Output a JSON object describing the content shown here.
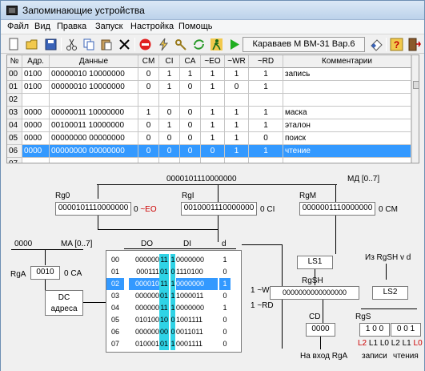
{
  "window": {
    "title": "Запоминающие устройства"
  },
  "menu": [
    "Файл",
    "Вид",
    "Правка",
    "Запуск",
    "Настройка",
    "Помощь"
  ],
  "toolbar": {
    "author_field": "Караваев М ВМ-31 Вар.6"
  },
  "icons": [
    "app-icon",
    "new-icon",
    "open-icon",
    "save-icon",
    "cut-icon",
    "copy-icon",
    "paste-icon",
    "delete-icon",
    "stop-icon",
    "step-icon",
    "key-icon",
    "refresh-icon",
    "run-man-icon",
    "play-icon",
    "eraser-icon",
    "help-icon",
    "exit-icon"
  ],
  "table": {
    "headers": [
      "№",
      "Адр.",
      "Данные",
      "CM",
      "CI",
      "CA",
      "~EO",
      "~WR",
      "~RD",
      "Комментарии"
    ],
    "rows": [
      [
        "00",
        "0100",
        "00000010  10000000",
        "0",
        "1",
        "1",
        "1",
        "1",
        "1",
        "запись"
      ],
      [
        "01",
        "0100",
        "00000010  10000000",
        "0",
        "1",
        "0",
        "1",
        "0",
        "1",
        ""
      ],
      [
        "02",
        "",
        "",
        "",
        "",
        "",
        "",
        "",
        "",
        ""
      ],
      [
        "03",
        "0000",
        "00000011  10000000",
        "1",
        "0",
        "0",
        "1",
        "1",
        "1",
        "маска"
      ],
      [
        "04",
        "0000",
        "00100011  10000000",
        "0",
        "1",
        "0",
        "1",
        "1",
        "1",
        "эталон"
      ],
      [
        "05",
        "0000",
        "00000000  00000000",
        "0",
        "0",
        "0",
        "1",
        "1",
        "0",
        "поиск"
      ],
      [
        "06",
        "0000",
        "00000000  00000000",
        "0",
        "0",
        "0",
        "0",
        "1",
        "1",
        "чтение"
      ],
      [
        "07",
        "",
        "",
        "",
        "",
        "",
        "",
        "",
        "",
        ""
      ]
    ],
    "selected_row": 6
  },
  "diagram": {
    "md_value": "0000101110000000",
    "md_label": "МД [0..7]",
    "rg0_label": "Rg0",
    "rg0_value": "0000101110000000",
    "rg0_sig": "0",
    "rg0_ctrl": "~EO",
    "rgi_label": "RgI",
    "rgi_value": "0010001110000000",
    "rgi_sig": "0",
    "rgi_ctrl": "CI",
    "rgm_label": "RgM",
    "rgm_value": "0000001110000000",
    "rgm_sig": "0",
    "rgm_ctrl": "CM",
    "ma_value": "0000",
    "ma_label": "MA [0..7]",
    "rga_label": "RgA",
    "rga_value": "0010",
    "rga_sig": "0",
    "rga_ctrl": "CA",
    "dc_label_1": "DC",
    "dc_label_2": "адреса",
    "do_label": "DO",
    "di_label": "DI",
    "d_label": "d",
    "wr_label": "1 ~WR",
    "rd_label": "1 ~RD",
    "memory": [
      {
        "addr": "00",
        "d1": "000000",
        "c": "11",
        "i": "1",
        "d2": "0000000",
        "f": "1"
      },
      {
        "addr": "01",
        "d1": "000111",
        "c": "01",
        "i": "0",
        "d2": "1110100",
        "f": "0"
      },
      {
        "addr": "02",
        "d1": "000010",
        "c": "11",
        "i": "1",
        "d2": "0000000",
        "f": "1"
      },
      {
        "addr": "03",
        "d1": "000000",
        "c": "01",
        "i": "1",
        "d2": "1000011",
        "f": "0"
      },
      {
        "addr": "04",
        "d1": "000000",
        "c": "11",
        "i": "1",
        "d2": "0000000",
        "f": "1"
      },
      {
        "addr": "05",
        "d1": "010100",
        "c": "10",
        "i": "0",
        "d2": "1001111",
        "f": "0"
      },
      {
        "addr": "06",
        "d1": "000000",
        "c": "00",
        "i": "0",
        "d2": "0011011",
        "f": "0"
      },
      {
        "addr": "07",
        "d1": "010001",
        "c": "01",
        "i": "1",
        "d2": "0001111",
        "f": "0"
      }
    ],
    "selected_mem_row": 2,
    "ls1_label": "LS1",
    "rgsh_label": "RgSH",
    "rgsh_value": "0000000000000000",
    "cd_label": "CD",
    "cd_value": "0000",
    "output_label": "На вход RgA",
    "rgsh_vd_label": "Из RgSH v d",
    "ls2_label": "LS2",
    "rgs_label": "RgS",
    "rgs_values": [
      "1",
      "0",
      "0",
      "0",
      "0",
      "1"
    ],
    "l_labels": [
      "L2",
      "L1",
      "L0",
      "L2",
      "L1",
      "L0"
    ],
    "zap_label": "записи",
    "chten_label": "чтения"
  },
  "colors": {
    "selection": "#3399ff",
    "cyan": "#2fd3e6",
    "red": "#cc0000"
  }
}
